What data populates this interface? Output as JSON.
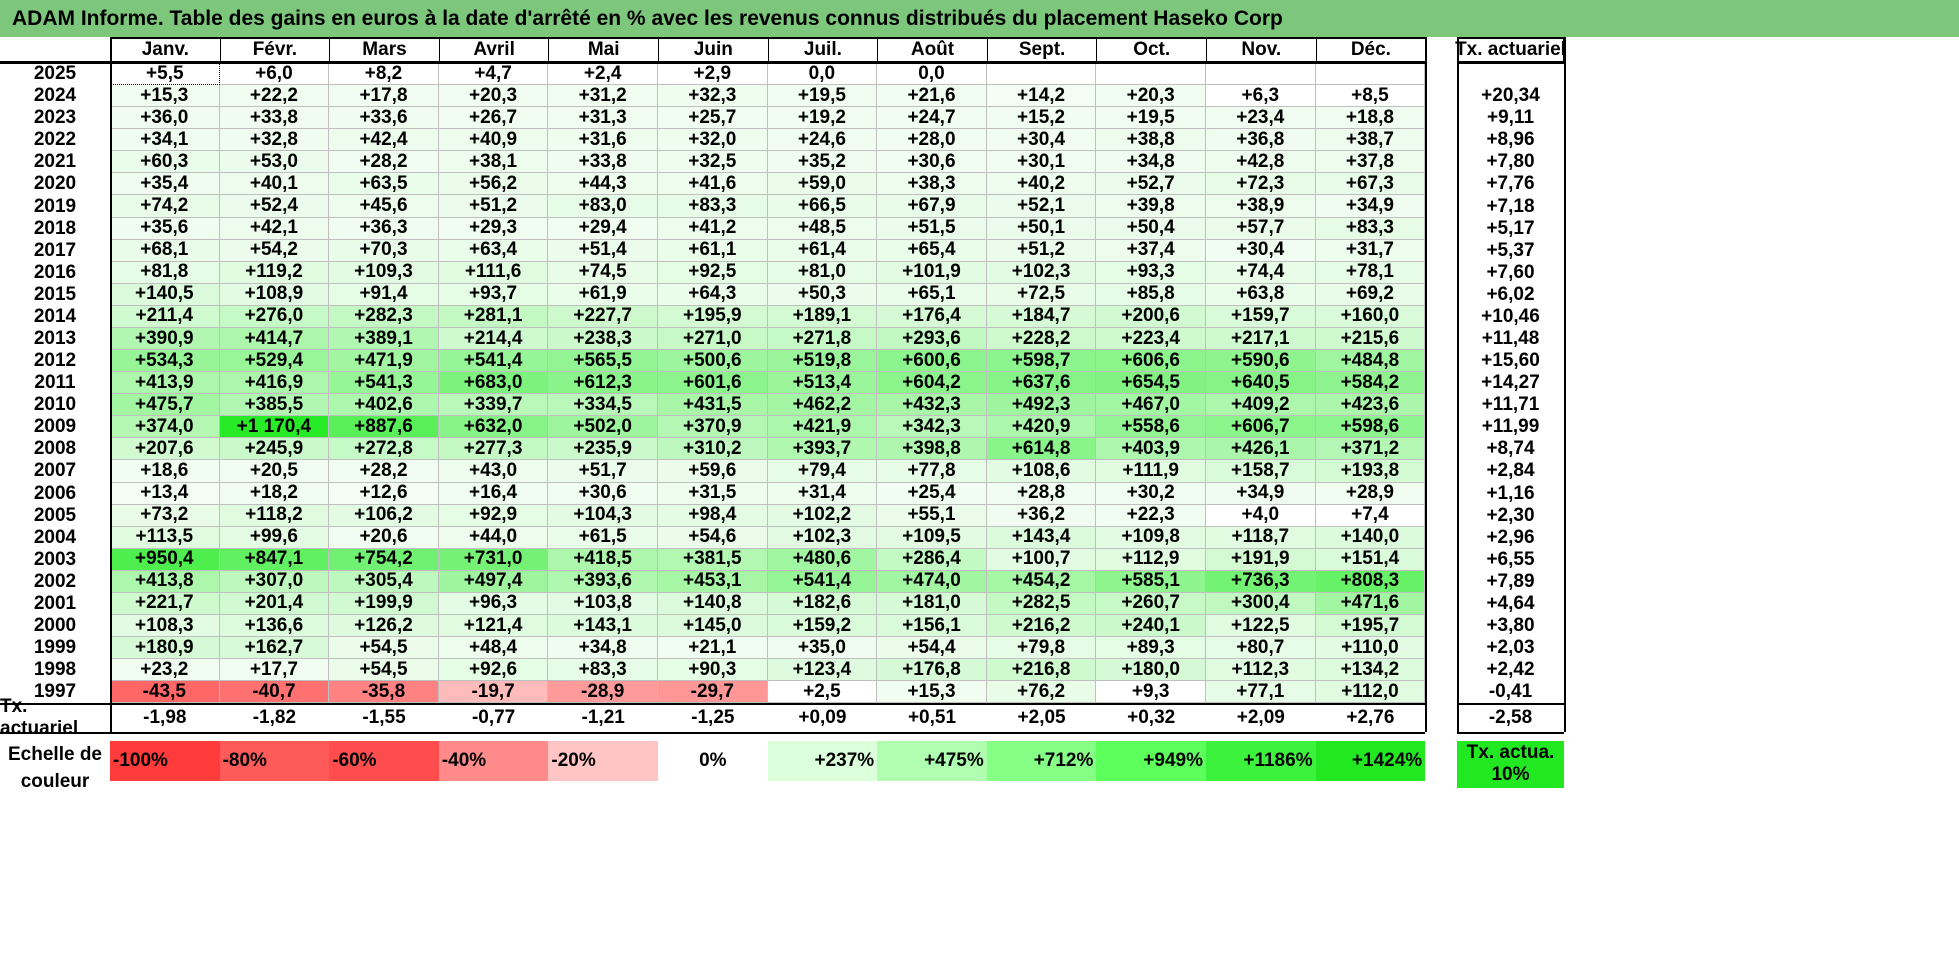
{
  "title": "ADAM Informe. Table des gains en euros à la date d'arrêté en % avec les revenus connus distribués du placement Haseko Corp",
  "months": [
    "Janv.",
    "Févr.",
    "Mars",
    "Avril",
    "Mai",
    "Juin",
    "Juil.",
    "Août",
    "Sept.",
    "Oct.",
    "Nov.",
    "Déc."
  ],
  "actuarial_header": "Tx. actuariel",
  "rows": [
    {
      "year": "2025",
      "vals": [
        "+5,5",
        "+6,0",
        "+8,2",
        "+4,7",
        "+2,4",
        "+2,9",
        "0,0",
        "0,0",
        "",
        "",
        "",
        ""
      ],
      "act": ""
    },
    {
      "year": "2024",
      "vals": [
        "+15,3",
        "+22,2",
        "+17,8",
        "+20,3",
        "+31,2",
        "+32,3",
        "+19,5",
        "+21,6",
        "+14,2",
        "+20,3",
        "+6,3",
        "+8,5"
      ],
      "act": "+20,34"
    },
    {
      "year": "2023",
      "vals": [
        "+36,0",
        "+33,8",
        "+33,6",
        "+26,7",
        "+31,3",
        "+25,7",
        "+19,2",
        "+24,7",
        "+15,2",
        "+19,5",
        "+23,4",
        "+18,8"
      ],
      "act": "+9,11"
    },
    {
      "year": "2022",
      "vals": [
        "+34,1",
        "+32,8",
        "+42,4",
        "+40,9",
        "+31,6",
        "+32,0",
        "+24,6",
        "+28,0",
        "+30,4",
        "+38,8",
        "+36,8",
        "+38,7"
      ],
      "act": "+8,96"
    },
    {
      "year": "2021",
      "vals": [
        "+60,3",
        "+53,0",
        "+28,2",
        "+38,1",
        "+33,8",
        "+32,5",
        "+35,2",
        "+30,6",
        "+30,1",
        "+34,8",
        "+42,8",
        "+37,8"
      ],
      "act": "+7,80"
    },
    {
      "year": "2020",
      "vals": [
        "+35,4",
        "+40,1",
        "+63,5",
        "+56,2",
        "+44,3",
        "+41,6",
        "+59,0",
        "+38,3",
        "+40,2",
        "+52,7",
        "+72,3",
        "+67,3"
      ],
      "act": "+7,76"
    },
    {
      "year": "2019",
      "vals": [
        "+74,2",
        "+52,4",
        "+45,6",
        "+51,2",
        "+83,0",
        "+83,3",
        "+66,5",
        "+67,9",
        "+52,1",
        "+39,8",
        "+38,9",
        "+34,9"
      ],
      "act": "+7,18"
    },
    {
      "year": "2018",
      "vals": [
        "+35,6",
        "+42,1",
        "+36,3",
        "+29,3",
        "+29,4",
        "+41,2",
        "+48,5",
        "+51,5",
        "+50,1",
        "+50,4",
        "+57,7",
        "+83,3"
      ],
      "act": "+5,17"
    },
    {
      "year": "2017",
      "vals": [
        "+68,1",
        "+54,2",
        "+70,3",
        "+63,4",
        "+51,4",
        "+61,1",
        "+61,4",
        "+65,4",
        "+51,2",
        "+37,4",
        "+30,4",
        "+31,7"
      ],
      "act": "+5,37"
    },
    {
      "year": "2016",
      "vals": [
        "+81,8",
        "+119,2",
        "+109,3",
        "+111,6",
        "+74,5",
        "+92,5",
        "+81,0",
        "+101,9",
        "+102,3",
        "+93,3",
        "+74,4",
        "+78,1"
      ],
      "act": "+7,60"
    },
    {
      "year": "2015",
      "vals": [
        "+140,5",
        "+108,9",
        "+91,4",
        "+93,7",
        "+61,9",
        "+64,3",
        "+50,3",
        "+65,1",
        "+72,5",
        "+85,8",
        "+63,8",
        "+69,2"
      ],
      "act": "+6,02"
    },
    {
      "year": "2014",
      "vals": [
        "+211,4",
        "+276,0",
        "+282,3",
        "+281,1",
        "+227,7",
        "+195,9",
        "+189,1",
        "+176,4",
        "+184,7",
        "+200,6",
        "+159,7",
        "+160,0"
      ],
      "act": "+10,46"
    },
    {
      "year": "2013",
      "vals": [
        "+390,9",
        "+414,7",
        "+389,1",
        "+214,4",
        "+238,3",
        "+271,0",
        "+271,8",
        "+293,6",
        "+228,2",
        "+223,4",
        "+217,1",
        "+215,6"
      ],
      "act": "+11,48"
    },
    {
      "year": "2012",
      "vals": [
        "+534,3",
        "+529,4",
        "+471,9",
        "+541,4",
        "+565,5",
        "+500,6",
        "+519,8",
        "+600,6",
        "+598,7",
        "+606,6",
        "+590,6",
        "+484,8"
      ],
      "act": "+15,60"
    },
    {
      "year": "2011",
      "vals": [
        "+413,9",
        "+416,9",
        "+541,3",
        "+683,0",
        "+612,3",
        "+601,6",
        "+513,4",
        "+604,2",
        "+637,6",
        "+654,5",
        "+640,5",
        "+584,2"
      ],
      "act": "+14,27"
    },
    {
      "year": "2010",
      "vals": [
        "+475,7",
        "+385,5",
        "+402,6",
        "+339,7",
        "+334,5",
        "+431,5",
        "+462,2",
        "+432,3",
        "+492,3",
        "+467,0",
        "+409,2",
        "+423,6"
      ],
      "act": "+11,71"
    },
    {
      "year": "2009",
      "vals": [
        "+374,0",
        "+1 170,4",
        "+887,6",
        "+632,0",
        "+502,0",
        "+370,9",
        "+421,9",
        "+342,3",
        "+420,9",
        "+558,6",
        "+606,7",
        "+598,6"
      ],
      "act": "+11,99"
    },
    {
      "year": "2008",
      "vals": [
        "+207,6",
        "+245,9",
        "+272,8",
        "+277,3",
        "+235,9",
        "+310,2",
        "+393,7",
        "+398,8",
        "+614,8",
        "+403,9",
        "+426,1",
        "+371,2"
      ],
      "act": "+8,74"
    },
    {
      "year": "2007",
      "vals": [
        "+18,6",
        "+20,5",
        "+28,2",
        "+43,0",
        "+51,7",
        "+59,6",
        "+79,4",
        "+77,8",
        "+108,6",
        "+111,9",
        "+158,7",
        "+193,8"
      ],
      "act": "+2,84"
    },
    {
      "year": "2006",
      "vals": [
        "+13,4",
        "+18,2",
        "+12,6",
        "+16,4",
        "+30,6",
        "+31,5",
        "+31,4",
        "+25,4",
        "+28,8",
        "+30,2",
        "+34,9",
        "+28,9"
      ],
      "act": "+1,16"
    },
    {
      "year": "2005",
      "vals": [
        "+73,2",
        "+118,2",
        "+106,2",
        "+92,9",
        "+104,3",
        "+98,4",
        "+102,2",
        "+55,1",
        "+36,2",
        "+22,3",
        "+4,0",
        "+7,4"
      ],
      "act": "+2,30"
    },
    {
      "year": "2004",
      "vals": [
        "+113,5",
        "+99,6",
        "+20,6",
        "+44,0",
        "+61,5",
        "+54,6",
        "+102,3",
        "+109,5",
        "+143,4",
        "+109,8",
        "+118,7",
        "+140,0"
      ],
      "act": "+2,96"
    },
    {
      "year": "2003",
      "vals": [
        "+950,4",
        "+847,1",
        "+754,2",
        "+731,0",
        "+418,5",
        "+381,5",
        "+480,6",
        "+286,4",
        "+100,7",
        "+112,9",
        "+191,9",
        "+151,4"
      ],
      "act": "+6,55"
    },
    {
      "year": "2002",
      "vals": [
        "+413,8",
        "+307,0",
        "+305,4",
        "+497,4",
        "+393,6",
        "+453,1",
        "+541,4",
        "+474,0",
        "+454,2",
        "+585,1",
        "+736,3",
        "+808,3"
      ],
      "act": "+7,89"
    },
    {
      "year": "2001",
      "vals": [
        "+221,7",
        "+201,4",
        "+199,9",
        "+96,3",
        "+103,8",
        "+140,8",
        "+182,6",
        "+181,0",
        "+282,5",
        "+260,7",
        "+300,4",
        "+471,6"
      ],
      "act": "+4,64"
    },
    {
      "year": "2000",
      "vals": [
        "+108,3",
        "+136,6",
        "+126,2",
        "+121,4",
        "+143,1",
        "+145,0",
        "+159,2",
        "+156,1",
        "+216,2",
        "+240,1",
        "+122,5",
        "+195,7"
      ],
      "act": "+3,80"
    },
    {
      "year": "1999",
      "vals": [
        "+180,9",
        "+162,7",
        "+54,5",
        "+48,4",
        "+34,8",
        "+21,1",
        "+35,0",
        "+54,4",
        "+79,8",
        "+89,3",
        "+80,7",
        "+110,0"
      ],
      "act": "+2,03"
    },
    {
      "year": "1998",
      "vals": [
        "+23,2",
        "+17,7",
        "+54,5",
        "+92,6",
        "+83,3",
        "+90,3",
        "+123,4",
        "+176,8",
        "+216,8",
        "+180,0",
        "+112,3",
        "+134,2"
      ],
      "act": "+2,42"
    },
    {
      "year": "1997",
      "vals": [
        "-43,5",
        "-40,7",
        "-35,8",
        "-19,7",
        "-28,9",
        "-29,7",
        "+2,5",
        "+15,3",
        "+76,2",
        "+9,3",
        "+77,1",
        "+112,0"
      ],
      "act": "-0,41"
    }
  ],
  "actuarial_row": {
    "label": "Tx. actuariel",
    "vals": [
      "-1,98",
      "-1,82",
      "-1,55",
      "-0,77",
      "-1,21",
      "-1,25",
      "+0,09",
      "+0,51",
      "+2,05",
      "+0,32",
      "+2,09",
      "+2,76"
    ],
    "total": "-2,58"
  },
  "scale": {
    "label": "Echelle de couleur",
    "items": [
      {
        "text": "-100%",
        "color": "#ff3b3b"
      },
      {
        "text": "-80%",
        "color": "#ff5a5a"
      },
      {
        "text": "-60%",
        "color": "#ff4d4d"
      },
      {
        "text": "-40%",
        "color": "#ff8a8a"
      },
      {
        "text": "-20%",
        "color": "#ffc4c4"
      },
      {
        "text": "0%",
        "color": "#ffffff"
      },
      {
        "text": "+237%",
        "color": "#dcffdc"
      },
      {
        "text": "+475%",
        "color": "#b0ffb0"
      },
      {
        "text": "+712%",
        "color": "#86ff86"
      },
      {
        "text": "+949%",
        "color": "#5cff5c"
      },
      {
        "text": "+1186%",
        "color": "#3cf23c"
      },
      {
        "text": "+1424%",
        "color": "#22e822"
      }
    ],
    "act_label": "Tx. actua. 10%",
    "act_color": "#22e822"
  }
}
